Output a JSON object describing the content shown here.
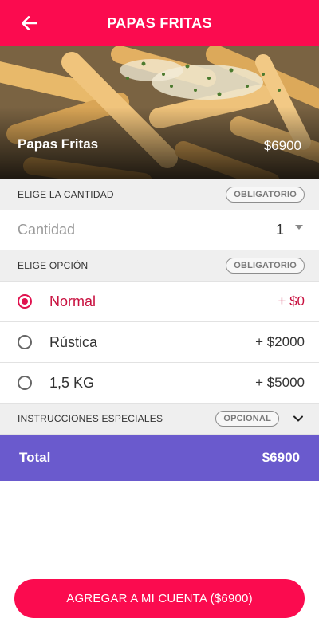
{
  "header": {
    "title": "PAPAS FRITAS",
    "back_icon": "arrow-left-icon"
  },
  "product": {
    "name": "Papas Fritas",
    "price": "$6900",
    "image": "fries-photo"
  },
  "quantity_section": {
    "label": "ELIGE LA CANTIDAD",
    "badge": "OBLIGATORIO"
  },
  "quantity": {
    "placeholder": "Cantidad",
    "value": "1"
  },
  "option_section": {
    "label": "ELIGE OPCIÓN",
    "badge": "OBLIGATORIO"
  },
  "options": [
    {
      "name": "Normal",
      "price": "+ $0",
      "selected": true
    },
    {
      "name": "Rústica",
      "price": "+ $2000",
      "selected": false
    },
    {
      "name": "1,5 KG",
      "price": "+ $5000",
      "selected": false
    }
  ],
  "instructions_section": {
    "label": "INSTRUCCIONES ESPECIALES",
    "badge": "OPCIONAL"
  },
  "total": {
    "label": "Total",
    "value": "$6900"
  },
  "cta": {
    "label": "AGREGAR A MI CUENTA ($6900)"
  },
  "colors": {
    "primary": "#fb0b4f",
    "accent": "#6a5acd",
    "selected": "#c8103f"
  }
}
